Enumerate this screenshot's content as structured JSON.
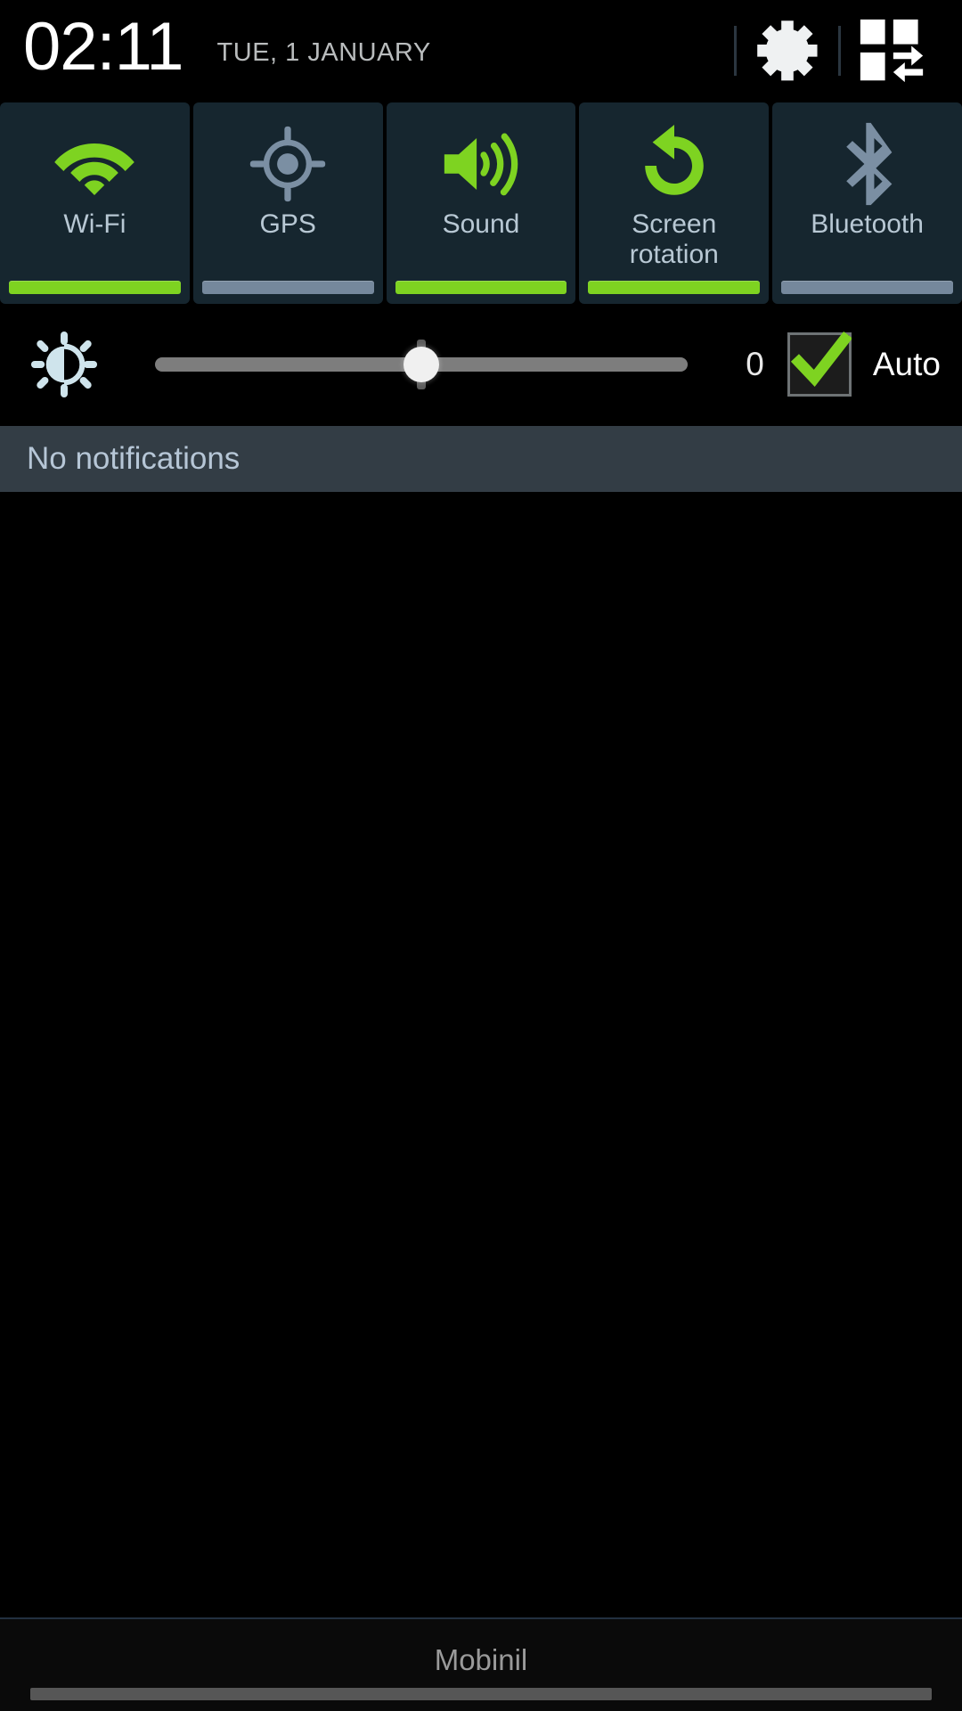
{
  "statusbar": {
    "clock": "02:11",
    "date": "TUE, 1 JANUARY",
    "settings_icon": "gear-icon",
    "quick_settings_icon": "grid-toggle-icon"
  },
  "quick_toggles": [
    {
      "label": "Wi-Fi",
      "icon": "wifi-icon",
      "state": "on",
      "bar_color": "#7ed321"
    },
    {
      "label": "GPS",
      "icon": "gps-crosshair-icon",
      "state": "off",
      "bar_color": "#75889c"
    },
    {
      "label": "Sound",
      "icon": "speaker-volume-icon",
      "state": "on",
      "bar_color": "#7ed321"
    },
    {
      "label": "Screen\nrotation",
      "icon": "rotate-ccw-icon",
      "state": "on",
      "bar_color": "#7ed321"
    },
    {
      "label": "Bluetooth",
      "icon": "bluetooth-icon",
      "state": "off",
      "bar_color": "#75889c"
    }
  ],
  "brightness": {
    "icon": "brightness-sun-icon",
    "value": "0",
    "slider_percent": 50,
    "auto_label": "Auto",
    "auto_checked": true,
    "check_color": "#7ed321"
  },
  "notifications": {
    "empty_text": "No notifications"
  },
  "footer": {
    "carrier": "Mobinil"
  },
  "colors": {
    "accent_green": "#7ed321",
    "inactive_blue": "#75889c",
    "tile_bg": "#16262f",
    "notif_bar_bg": "#333d45",
    "page_bg": "#000000"
  }
}
